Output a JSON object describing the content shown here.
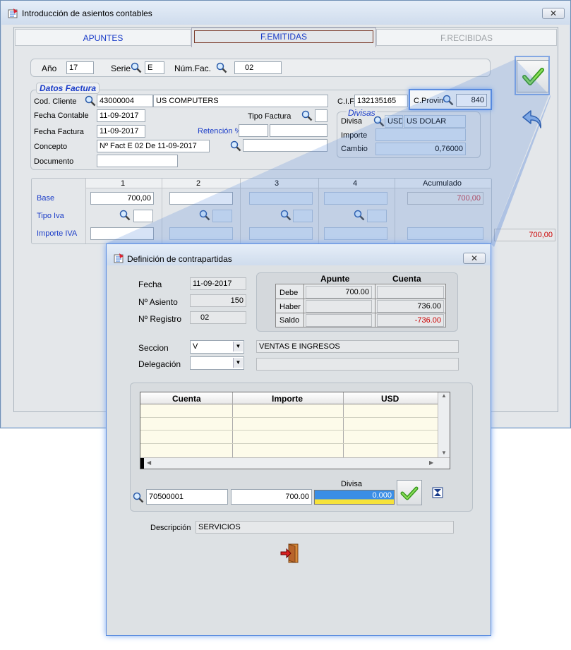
{
  "main_window": {
    "title": "Introducción de asientos contables",
    "close": "✕",
    "tabs": [
      {
        "label": "APUNTES"
      },
      {
        "label": "F.EMITIDAS"
      },
      {
        "label": "F.RECIBIDAS"
      }
    ],
    "header": {
      "ano_label": "Año",
      "ano": "17",
      "serie_label": "Serie",
      "serie": "E",
      "numfac_label": "Núm.Fac.",
      "numfac": "02"
    },
    "datos_factura": {
      "title": "Datos Factura",
      "cod_cliente_label": "Cod. Cliente",
      "cod_cliente": "43000004",
      "cliente_nombre": "US COMPUTERS",
      "cif_label": "C.I.F.",
      "cif": "132135165",
      "cprovin_label": "C.Provin",
      "cprovin": "840",
      "fecha_contable_label": "Fecha Contable",
      "fecha_contable": "11-09-2017",
      "tipo_factura_label": "Tipo Factura",
      "fecha_factura_label": "Fecha Factura",
      "fecha_factura": "11-09-2017",
      "retencion_label": "Retención %",
      "concepto_label": "Concepto",
      "concepto": "Nº Fact E 02 De 11-09-2017",
      "documento_label": "Documento"
    },
    "divisas": {
      "title": "Divisas",
      "divisa_label": "Divisa",
      "divisa_code": "USD",
      "divisa_name": "US DOLAR",
      "importe_label": "Importe",
      "cambio_label": "Cambio",
      "cambio": "0,76000"
    },
    "grid": {
      "cols": [
        "1",
        "2",
        "3",
        "4",
        "Acumulado"
      ],
      "base_label": "Base",
      "tipo_iva_label": "Tipo Iva",
      "importe_iva_label": "Importe IVA",
      "base_1": "700,00",
      "acumulado_base": "700,00",
      "acumulado_iva": "700,00"
    }
  },
  "dialog": {
    "title": "Definición de contrapartidas",
    "close": "✕",
    "fecha_label": "Fecha",
    "fecha": "11-09-2017",
    "asiento_label": "Nº Asiento",
    "asiento": "150",
    "registro_label": "Nº Registro",
    "registro": "02",
    "summary": {
      "col_apunte": "Apunte",
      "col_cuenta": "Cuenta",
      "debe_label": "Debe",
      "debe_apunte": "700.00",
      "haber_label": "Haber",
      "haber_cuenta": "736.00",
      "saldo_label": "Saldo",
      "saldo_cuenta": "-736.00"
    },
    "seccion_label": "Seccion",
    "seccion": "V",
    "seccion_desc": "VENTAS  E INGRESOS",
    "delegacion_label": "Delegación",
    "table": {
      "headers": [
        "Cuenta",
        "Importe",
        "USD"
      ]
    },
    "entry": {
      "cuenta": "70500001",
      "importe": "700.00",
      "divisa_label": "Divisa",
      "divisa_value": "0.000"
    },
    "descripcion_label": "Descripción",
    "descripcion": "SERVICIOS"
  },
  "colors": {
    "accent_blue": "#1a3cc8",
    "negative_red": "#cc0000",
    "divisa_yellow": "#f6e23a",
    "divisa_blue": "#3a8ee6"
  }
}
